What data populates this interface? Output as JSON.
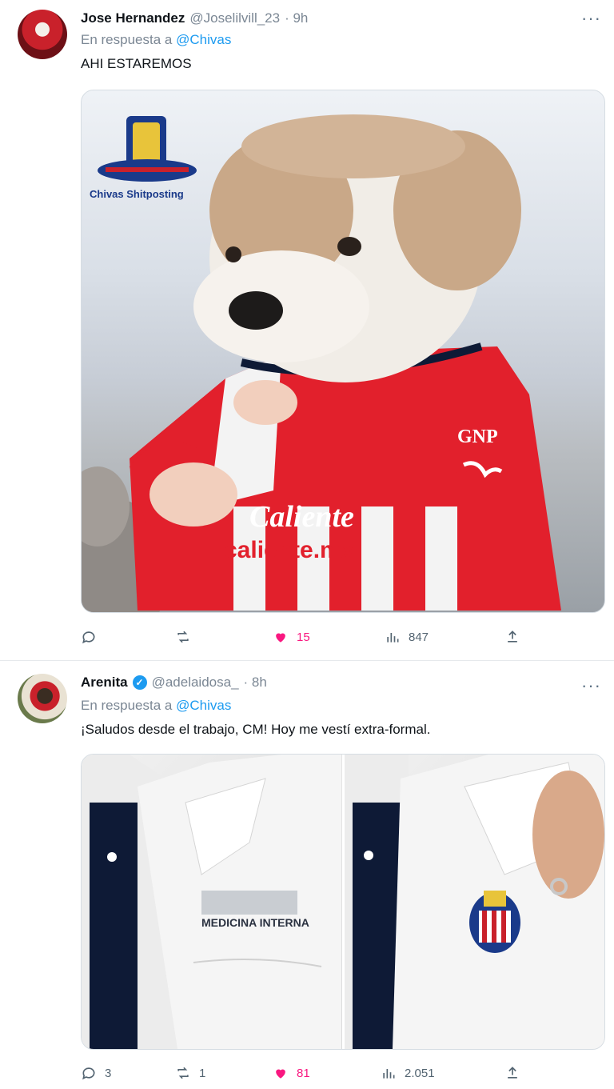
{
  "tweets": [
    {
      "name": "Jose Hernandez",
      "handle": "@Joselilvill_23",
      "time": "· 9h",
      "more": "···",
      "reply_prefix": "En respuesta a",
      "reply_handle": "@Chivas",
      "text": "AHI ESTAREMOS",
      "media": {
        "logo_text": "Chivas Shitposting",
        "shirt_text": "caliente.mx",
        "shirt_script": "Caliente",
        "sponsor": "GNP"
      },
      "actions": {
        "replies": "",
        "retweets": "",
        "likes": "15",
        "views": "847"
      }
    },
    {
      "name": "Arenita",
      "handle": "@adelaidosa_",
      "time": "· 8h",
      "more": "···",
      "reply_prefix": "En respuesta a",
      "reply_handle": "@Chivas",
      "text": "¡Saludos desde el trabajo, CM! Hoy me vestí extra-formal.",
      "media": {
        "embroidery": "MEDICINA INTERNA"
      },
      "actions": {
        "replies": "3",
        "retweets": "1",
        "likes": "81",
        "views": "2.051"
      }
    }
  ],
  "colors": {
    "accent": "#1d9bf0",
    "like": "#f91880",
    "muted": "#536471"
  }
}
